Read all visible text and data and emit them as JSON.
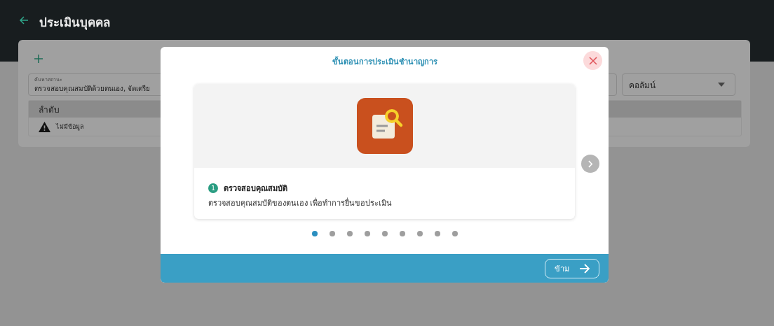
{
  "header": {
    "title": "ประเมินบุคคล"
  },
  "search": {
    "label": "ค้นหาสถานะ",
    "value": "ตรวจสอบคุณสมบัติด้วยตนเอง, จัดเตรีย"
  },
  "column_select": {
    "value": "คอลัมน์"
  },
  "table": {
    "columns": [
      "ลำดับ"
    ],
    "empty_text": "ไม่มีข้อมูล"
  },
  "modal": {
    "title": "ขั้นตอนการประเมินชำนาญการ",
    "step": {
      "number": "1",
      "title": "ตรวจสอบคุณสมบัติ",
      "description": "ตรวจสอบคุณสมบัติของตนเอง เพื่อทำการยื่นขอประเมิน"
    },
    "dots": [
      {
        "selected": true
      },
      {
        "selected": false
      },
      {
        "selected": false
      },
      {
        "selected": false
      },
      {
        "selected": false
      },
      {
        "selected": false
      },
      {
        "selected": false
      },
      {
        "selected": false
      },
      {
        "selected": false
      }
    ],
    "skip_button": "ข้าม"
  }
}
